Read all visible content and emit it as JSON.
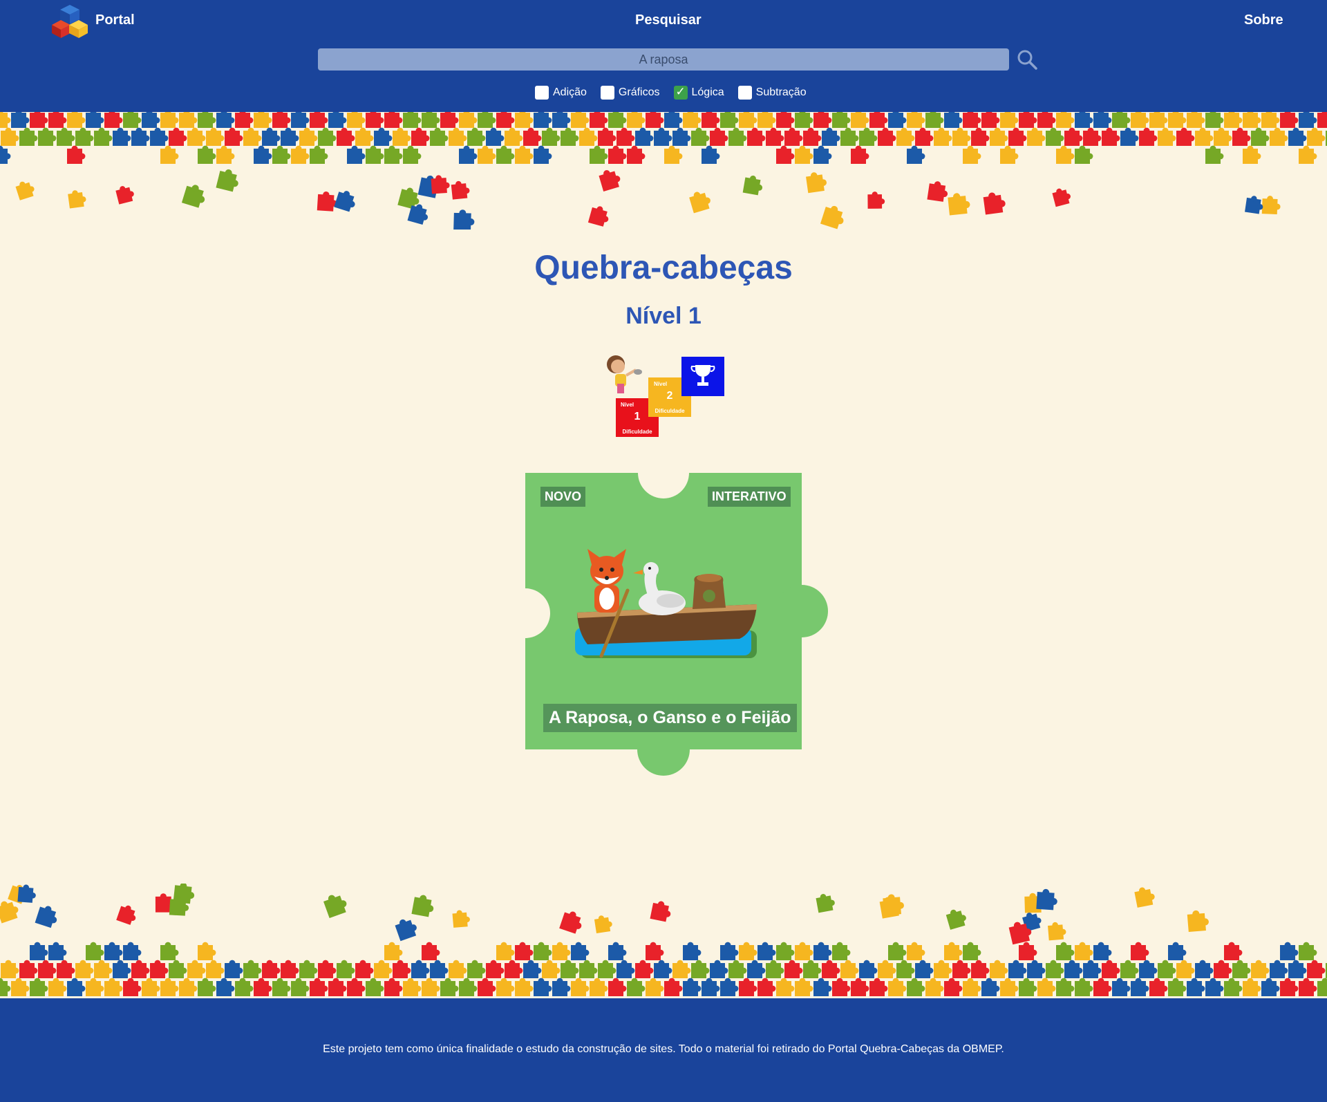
{
  "header": {
    "nav": {
      "portal": "Portal",
      "search": "Pesquisar",
      "about": "Sobre"
    },
    "search": {
      "value": "A raposa"
    },
    "filters": [
      {
        "label": "Adição",
        "checked": false
      },
      {
        "label": "Gráficos",
        "checked": false
      },
      {
        "label": "Lógica",
        "checked": true
      },
      {
        "label": "Subtração",
        "checked": false
      }
    ]
  },
  "main": {
    "title": "Quebra-cabeças",
    "subtitle": "Nível 1",
    "level_graphic": {
      "step1_label": "Nível",
      "step1_number": "1",
      "step1_caption": "Dificuldade",
      "step2_label": "Nível",
      "step2_number": "2",
      "step2_caption": "Dificuldade",
      "trophy": "trophy-icon"
    },
    "card": {
      "badge_new": "NOVO",
      "badge_interactive": "INTERATIVO",
      "title": "A Raposa, o Ganso e o Feijão",
      "color": "#78c86e"
    }
  },
  "footer": {
    "text": "Este projeto tem como única finalidade o estudo da construção de sites. Todo o material foi retirado do Portal Quebra-Cabeças da OBMEP."
  },
  "colors": {
    "header_bg": "#1a449b",
    "page_bg": "#fbf4e2",
    "title": "#2d56b5",
    "puzzle": [
      "#e8222a",
      "#f6b620",
      "#1c5aa8",
      "#76a826"
    ]
  }
}
